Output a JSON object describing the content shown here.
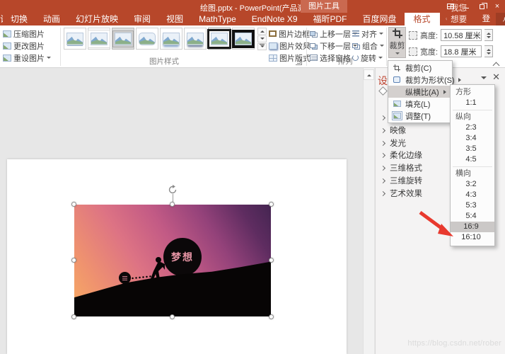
{
  "title_bar": {
    "title": "绘图.pptx - PowerPoint(产品激活失败)",
    "context_tab": "图片工具"
  },
  "tabs": {
    "partial_left": "计",
    "items": [
      "切换",
      "动画",
      "幻灯片放映",
      "审阅",
      "视图",
      "MathType",
      "EndNote X9",
      "福昕PDF",
      "百度网盘"
    ],
    "active": "格式",
    "tell_me": "告诉我您想要做什么...",
    "sign_in": "登录",
    "share": "共享"
  },
  "ribbon": {
    "adjust": {
      "compress": "压缩图片",
      "change": "更改图片",
      "reset": "重设图片"
    },
    "styles": {
      "group_label": "图片样式",
      "border": "图片边框",
      "effects": "图片效果",
      "layout": "图片版式"
    },
    "arrange": {
      "group_label": "排列",
      "bring_forward": "上移一层",
      "send_backward": "下移一层",
      "selection_pane": "选择窗格",
      "align": "对齐",
      "group": "组合",
      "rotate": "旋转"
    },
    "size": {
      "crop": "裁剪",
      "height_label": "高度:",
      "height_value": "10.58 厘米",
      "width_label": "宽度:",
      "width_value": "18.8 厘米"
    }
  },
  "crop_menu": {
    "items": [
      "裁剪(C)",
      "裁剪为形状(S)",
      "纵横比(A)",
      "填充(L)",
      "调整(T)"
    ],
    "highlighted": "纵横比(A)"
  },
  "ratio_menu": {
    "square_header": "方形",
    "square_items": [
      "1:1"
    ],
    "portrait_header": "纵向",
    "portrait_items": [
      "2:3",
      "3:4",
      "3:5",
      "4:5"
    ],
    "landscape_header": "横向",
    "landscape_items": [
      "3:2",
      "4:3",
      "5:3",
      "5:4",
      "16:9",
      "16:10"
    ],
    "selected": "16:9"
  },
  "format_pane": {
    "title_partial": "设",
    "sections": [
      "映像",
      "发光",
      "柔化边缘",
      "三维格式",
      "三维旋转",
      "艺术效果"
    ]
  },
  "slide": {
    "ball_text": "梦想"
  },
  "watermark": "https://blog.csdn.net/rober",
  "colors": {
    "titlebar": "#B7472A",
    "menu_highlight": "#D4D0CE",
    "arrow": "#E8392E"
  }
}
